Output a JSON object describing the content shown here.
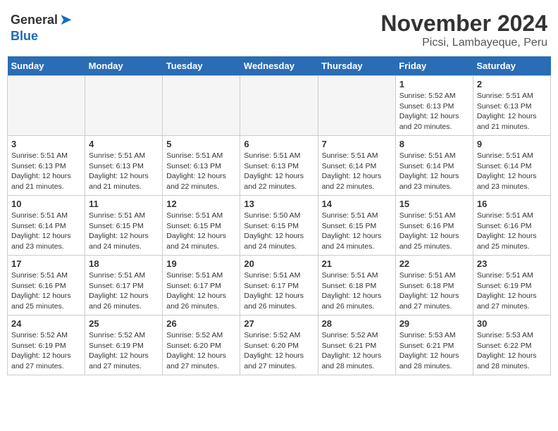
{
  "header": {
    "logo_general": "General",
    "logo_blue": "Blue",
    "title": "November 2024",
    "subtitle": "Picsi, Lambayeque, Peru"
  },
  "days_of_week": [
    "Sunday",
    "Monday",
    "Tuesday",
    "Wednesday",
    "Thursday",
    "Friday",
    "Saturday"
  ],
  "weeks": [
    [
      {
        "day": "",
        "empty": true
      },
      {
        "day": "",
        "empty": true
      },
      {
        "day": "",
        "empty": true
      },
      {
        "day": "",
        "empty": true
      },
      {
        "day": "",
        "empty": true
      },
      {
        "day": "1",
        "sunrise": "Sunrise: 5:52 AM",
        "sunset": "Sunset: 6:13 PM",
        "daylight": "Daylight: 12 hours and 20 minutes."
      },
      {
        "day": "2",
        "sunrise": "Sunrise: 5:51 AM",
        "sunset": "Sunset: 6:13 PM",
        "daylight": "Daylight: 12 hours and 21 minutes."
      }
    ],
    [
      {
        "day": "3",
        "sunrise": "Sunrise: 5:51 AM",
        "sunset": "Sunset: 6:13 PM",
        "daylight": "Daylight: 12 hours and 21 minutes."
      },
      {
        "day": "4",
        "sunrise": "Sunrise: 5:51 AM",
        "sunset": "Sunset: 6:13 PM",
        "daylight": "Daylight: 12 hours and 21 minutes."
      },
      {
        "day": "5",
        "sunrise": "Sunrise: 5:51 AM",
        "sunset": "Sunset: 6:13 PM",
        "daylight": "Daylight: 12 hours and 22 minutes."
      },
      {
        "day": "6",
        "sunrise": "Sunrise: 5:51 AM",
        "sunset": "Sunset: 6:13 PM",
        "daylight": "Daylight: 12 hours and 22 minutes."
      },
      {
        "day": "7",
        "sunrise": "Sunrise: 5:51 AM",
        "sunset": "Sunset: 6:14 PM",
        "daylight": "Daylight: 12 hours and 22 minutes."
      },
      {
        "day": "8",
        "sunrise": "Sunrise: 5:51 AM",
        "sunset": "Sunset: 6:14 PM",
        "daylight": "Daylight: 12 hours and 23 minutes."
      },
      {
        "day": "9",
        "sunrise": "Sunrise: 5:51 AM",
        "sunset": "Sunset: 6:14 PM",
        "daylight": "Daylight: 12 hours and 23 minutes."
      }
    ],
    [
      {
        "day": "10",
        "sunrise": "Sunrise: 5:51 AM",
        "sunset": "Sunset: 6:14 PM",
        "daylight": "Daylight: 12 hours and 23 minutes."
      },
      {
        "day": "11",
        "sunrise": "Sunrise: 5:51 AM",
        "sunset": "Sunset: 6:15 PM",
        "daylight": "Daylight: 12 hours and 24 minutes."
      },
      {
        "day": "12",
        "sunrise": "Sunrise: 5:51 AM",
        "sunset": "Sunset: 6:15 PM",
        "daylight": "Daylight: 12 hours and 24 minutes."
      },
      {
        "day": "13",
        "sunrise": "Sunrise: 5:50 AM",
        "sunset": "Sunset: 6:15 PM",
        "daylight": "Daylight: 12 hours and 24 minutes."
      },
      {
        "day": "14",
        "sunrise": "Sunrise: 5:51 AM",
        "sunset": "Sunset: 6:15 PM",
        "daylight": "Daylight: 12 hours and 24 minutes."
      },
      {
        "day": "15",
        "sunrise": "Sunrise: 5:51 AM",
        "sunset": "Sunset: 6:16 PM",
        "daylight": "Daylight: 12 hours and 25 minutes."
      },
      {
        "day": "16",
        "sunrise": "Sunrise: 5:51 AM",
        "sunset": "Sunset: 6:16 PM",
        "daylight": "Daylight: 12 hours and 25 minutes."
      }
    ],
    [
      {
        "day": "17",
        "sunrise": "Sunrise: 5:51 AM",
        "sunset": "Sunset: 6:16 PM",
        "daylight": "Daylight: 12 hours and 25 minutes."
      },
      {
        "day": "18",
        "sunrise": "Sunrise: 5:51 AM",
        "sunset": "Sunset: 6:17 PM",
        "daylight": "Daylight: 12 hours and 26 minutes."
      },
      {
        "day": "19",
        "sunrise": "Sunrise: 5:51 AM",
        "sunset": "Sunset: 6:17 PM",
        "daylight": "Daylight: 12 hours and 26 minutes."
      },
      {
        "day": "20",
        "sunrise": "Sunrise: 5:51 AM",
        "sunset": "Sunset: 6:17 PM",
        "daylight": "Daylight: 12 hours and 26 minutes."
      },
      {
        "day": "21",
        "sunrise": "Sunrise: 5:51 AM",
        "sunset": "Sunset: 6:18 PM",
        "daylight": "Daylight: 12 hours and 26 minutes."
      },
      {
        "day": "22",
        "sunrise": "Sunrise: 5:51 AM",
        "sunset": "Sunset: 6:18 PM",
        "daylight": "Daylight: 12 hours and 27 minutes."
      },
      {
        "day": "23",
        "sunrise": "Sunrise: 5:51 AM",
        "sunset": "Sunset: 6:19 PM",
        "daylight": "Daylight: 12 hours and 27 minutes."
      }
    ],
    [
      {
        "day": "24",
        "sunrise": "Sunrise: 5:52 AM",
        "sunset": "Sunset: 6:19 PM",
        "daylight": "Daylight: 12 hours and 27 minutes."
      },
      {
        "day": "25",
        "sunrise": "Sunrise: 5:52 AM",
        "sunset": "Sunset: 6:19 PM",
        "daylight": "Daylight: 12 hours and 27 minutes."
      },
      {
        "day": "26",
        "sunrise": "Sunrise: 5:52 AM",
        "sunset": "Sunset: 6:20 PM",
        "daylight": "Daylight: 12 hours and 27 minutes."
      },
      {
        "day": "27",
        "sunrise": "Sunrise: 5:52 AM",
        "sunset": "Sunset: 6:20 PM",
        "daylight": "Daylight: 12 hours and 27 minutes."
      },
      {
        "day": "28",
        "sunrise": "Sunrise: 5:52 AM",
        "sunset": "Sunset: 6:21 PM",
        "daylight": "Daylight: 12 hours and 28 minutes."
      },
      {
        "day": "29",
        "sunrise": "Sunrise: 5:53 AM",
        "sunset": "Sunset: 6:21 PM",
        "daylight": "Daylight: 12 hours and 28 minutes."
      },
      {
        "day": "30",
        "sunrise": "Sunrise: 5:53 AM",
        "sunset": "Sunset: 6:22 PM",
        "daylight": "Daylight: 12 hours and 28 minutes."
      }
    ]
  ]
}
